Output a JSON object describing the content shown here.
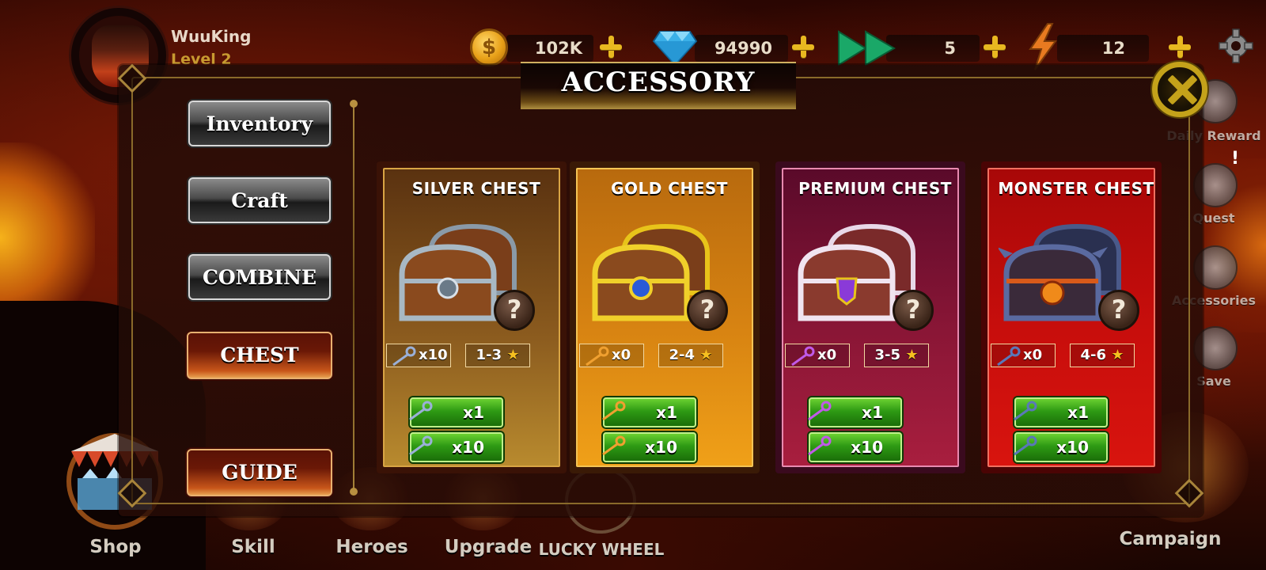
{
  "player": {
    "name": "WuuKing",
    "level": "Level 2"
  },
  "resources": {
    "coins": "102K",
    "gems": "94990",
    "speed": "5",
    "energy": "12"
  },
  "panel": {
    "title": "ACCESSORY",
    "menu": [
      "Inventory",
      "Craft",
      "COMBINE",
      "CHEST"
    ],
    "guide": "GUIDE"
  },
  "chests": [
    {
      "title": "SILVER CHEST",
      "keys": "x10",
      "stars": "1-3",
      "buy_one": "x1",
      "buy_ten": "x10"
    },
    {
      "title": "GOLD CHEST",
      "keys": "x0",
      "stars": "2-4",
      "buy_one": "x1",
      "buy_ten": "x10"
    },
    {
      "title": "PREMIUM CHEST",
      "keys": "x0",
      "stars": "3-5",
      "buy_one": "x1",
      "buy_ten": "x10"
    },
    {
      "title": "MONSTER CHEST",
      "keys": "x0",
      "stars": "4-6",
      "buy_one": "x1",
      "buy_ten": "x10"
    }
  ],
  "help_glyph": "?",
  "star_glyph": "★",
  "alert_glyph": "!",
  "side_menu": [
    "Daily Reward",
    "Quest",
    "Accessories",
    "Save"
  ],
  "bottom_nav": [
    "Shop",
    "Skill",
    "Heroes",
    "Upgrade",
    "LUCKY WHEEL",
    "Campaign"
  ],
  "colors": {
    "silver_card": "#a87a2a",
    "gold_card": "#e08a12",
    "premium_card": "#9a1a3a",
    "monster_card": "#c8100e",
    "buy_green": "#2e9a14",
    "star": "#f6c020"
  }
}
